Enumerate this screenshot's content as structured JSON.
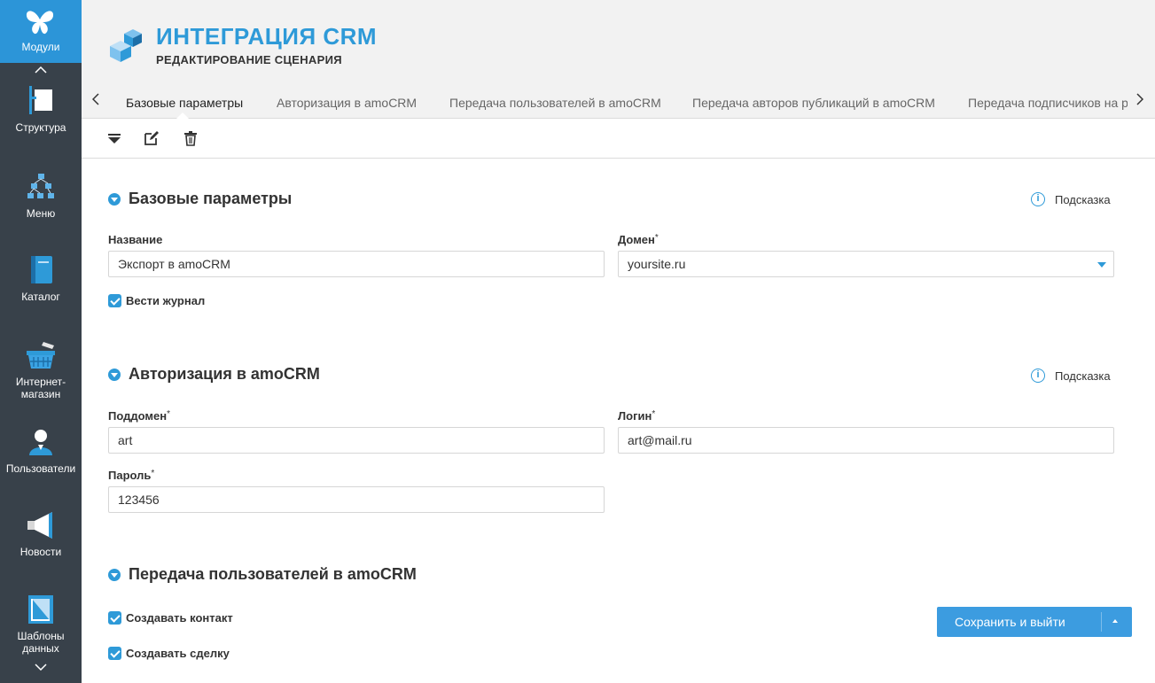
{
  "sidebar": {
    "top": {
      "label": "Модули",
      "icon": "butterfly-icon"
    },
    "scroll_up": "⌃",
    "scroll_down": "⌄",
    "items": [
      {
        "label": "Структура",
        "icon": "structure-icon"
      },
      {
        "label": "Меню",
        "icon": "menu-tree-icon"
      },
      {
        "label": "Каталог",
        "icon": "catalog-book-icon"
      },
      {
        "label": "Интернет-\nмагазин",
        "icon": "basket-icon"
      },
      {
        "label": "Пользователи",
        "icon": "user-icon"
      },
      {
        "label": "Новости",
        "icon": "megaphone-icon"
      },
      {
        "label": "Шаблоны\nданных",
        "icon": "template-icon"
      }
    ]
  },
  "header": {
    "title": "ИНТЕГРАЦИЯ CRM",
    "subtitle": "РЕДАКТИРОВАНИЕ СЦЕНАРИЯ"
  },
  "tabs": [
    {
      "label": "Базовые параметры",
      "active": true
    },
    {
      "label": "Авторизация в amoCRM"
    },
    {
      "label": "Передача пользователей в amoCRM"
    },
    {
      "label": "Передача авторов публикаций в amoCRM"
    },
    {
      "label": "Передача подписчиков на р"
    }
  ],
  "sections": {
    "basic": {
      "title": "Базовые параметры",
      "hint": "Подсказка",
      "name_label": "Название",
      "name_value": "Экспорт в amoCRM",
      "domain_label": "Домен",
      "domain_value": "yoursite.ru",
      "log_label": "Вести журнал"
    },
    "auth": {
      "title": "Авторизация в amoCRM",
      "hint": "Подсказка",
      "subdomain_label": "Поддомен",
      "subdomain_value": "art",
      "login_label": "Логин",
      "login_value": "art@mail.ru",
      "password_label": "Пароль",
      "password_value": "123456"
    },
    "users": {
      "title": "Передача пользователей в amoCRM",
      "create_contact": "Создавать контакт",
      "create_deal": "Создавать сделку"
    }
  },
  "required_mark": "*",
  "save_button": "Сохранить и выйти",
  "colors": {
    "accent": "#2e9ad8",
    "sidebar": "#38414a",
    "sidebar_active": "#2c95d8"
  }
}
